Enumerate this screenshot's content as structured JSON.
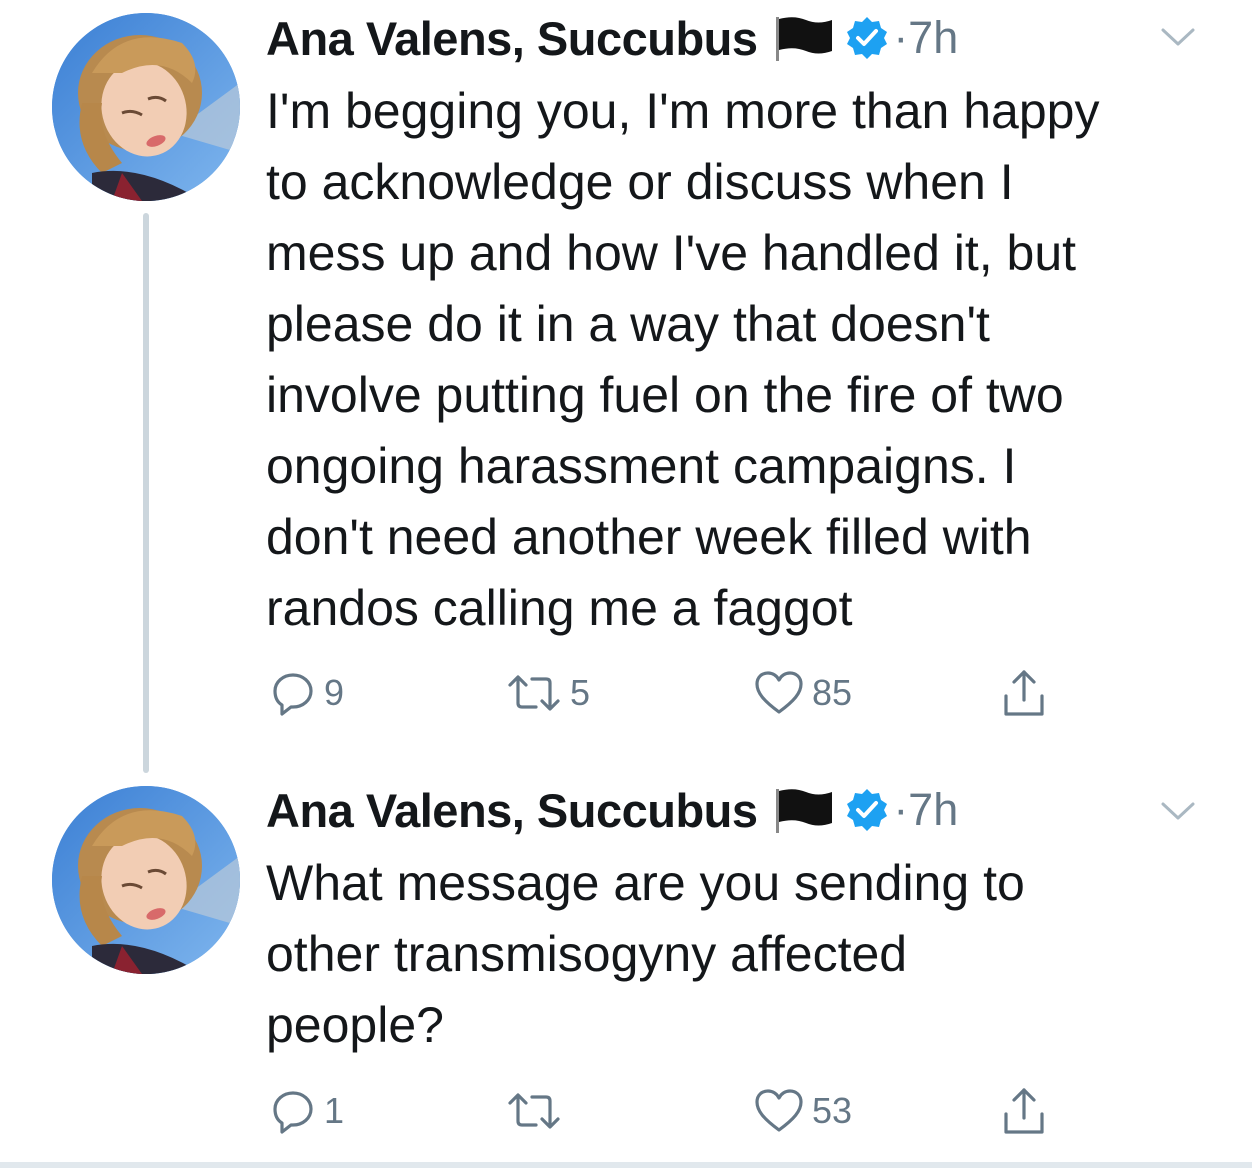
{
  "tweets": [
    {
      "author": {
        "display_name": "Ana Valens, Succubus",
        "flag_icon": "black-flag-icon",
        "verified_icon": "verified-badge-icon",
        "verified_color": "#1da1f2"
      },
      "separator": "·",
      "time": "7h",
      "text_lines": [
        "I'm begging you, I'm more than happy",
        "to acknowledge or discuss when I",
        "mess up and how I've handled it, but",
        "please do it in a way that doesn't",
        "involve putting fuel on the fire of two",
        "ongoing harassment campaigns. I",
        "don't need another week filled with",
        "randos calling me a faggot"
      ],
      "actions": {
        "reply_icon": "reply-icon",
        "reply_count": "9",
        "retweet_icon": "retweet-icon",
        "retweet_count": "5",
        "like_icon": "heart-icon",
        "like_count": "85",
        "share_icon": "share-icon"
      }
    },
    {
      "author": {
        "display_name": "Ana Valens, Succubus",
        "flag_icon": "black-flag-icon",
        "verified_icon": "verified-badge-icon",
        "verified_color": "#1da1f2"
      },
      "separator": "·",
      "time": "7h",
      "text_lines": [
        "What message are you sending to",
        "other transmisogyny affected",
        "people?"
      ],
      "actions": {
        "reply_icon": "reply-icon",
        "reply_count": "1",
        "retweet_icon": "retweet-icon",
        "retweet_count": "",
        "like_icon": "heart-icon",
        "like_count": "53",
        "share_icon": "share-icon"
      }
    }
  ],
  "colors": {
    "text_primary": "#14171a",
    "text_secondary": "#657786",
    "thread_line": "#ccd6dd",
    "accent": "#1da1f2"
  }
}
